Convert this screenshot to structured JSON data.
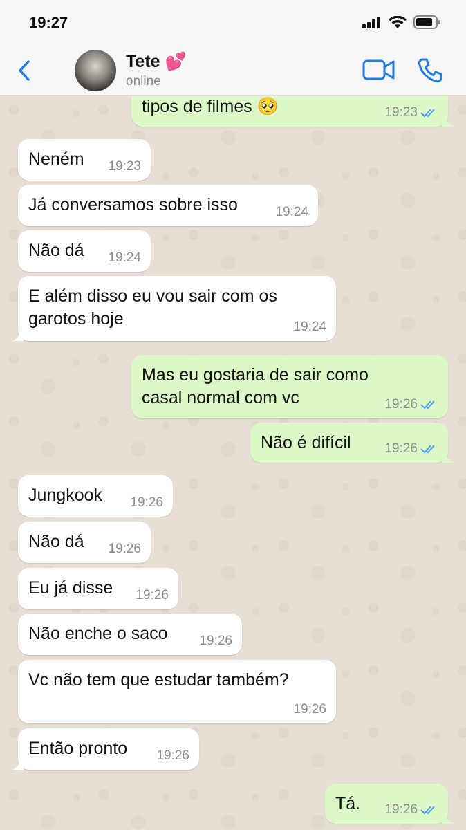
{
  "status_bar": {
    "time": "19:27"
  },
  "header": {
    "contact_name": "Tete 💕",
    "contact_status": "online"
  },
  "colors": {
    "accent": "#1f7ee0",
    "incoming_bubble": "#ffffff",
    "outgoing_bubble": "#dcf8c6",
    "read_tick": "#4fa3f7"
  },
  "messages": [
    {
      "direction": "out",
      "text": "tipos de filmes 🥺",
      "time": "19:23",
      "read": true
    },
    {
      "direction": "in",
      "text": "Neném",
      "time": "19:23"
    },
    {
      "direction": "in",
      "text": "Já conversamos sobre isso",
      "time": "19:24"
    },
    {
      "direction": "in",
      "text": "Não dá",
      "time": "19:24"
    },
    {
      "direction": "in",
      "text_lines": [
        "E além disso eu vou sair com os",
        "garotos hoje"
      ],
      "time": "19:24"
    },
    {
      "direction": "out",
      "text_lines": [
        "Mas eu gostaria de sair como",
        "casal normal com vc"
      ],
      "time": "19:26",
      "read": true
    },
    {
      "direction": "out",
      "text": "Não é difícil",
      "time": "19:26",
      "read": true
    },
    {
      "direction": "in",
      "text": "Jungkook",
      "time": "19:26"
    },
    {
      "direction": "in",
      "text": "Não dá",
      "time": "19:26"
    },
    {
      "direction": "in",
      "text": "Eu já disse",
      "time": "19:26"
    },
    {
      "direction": "in",
      "text": "Não enche o saco",
      "time": "19:26"
    },
    {
      "direction": "in",
      "text": "Vc não tem que estudar também?",
      "time": "19:26"
    },
    {
      "direction": "in",
      "text": "Então pronto",
      "time": "19:26"
    },
    {
      "direction": "out",
      "text": "Tá.",
      "time": "19:26",
      "read": true
    }
  ]
}
